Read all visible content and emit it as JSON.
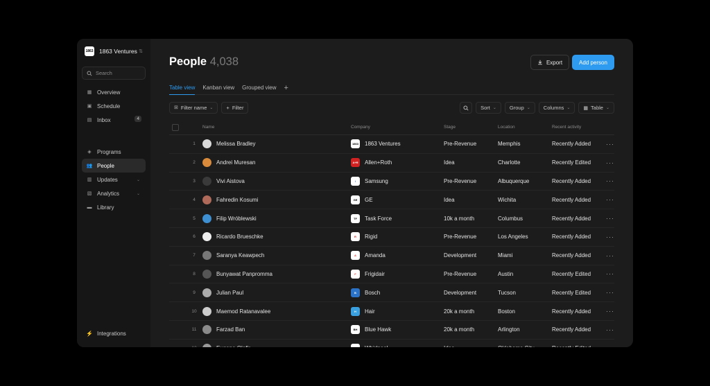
{
  "workspace": {
    "name": "1863 Ventures",
    "logo_text": "1863"
  },
  "search": {
    "placeholder": "Search"
  },
  "nav": {
    "primary": [
      {
        "label": "Overview",
        "icon": "grid-icon"
      },
      {
        "label": "Schedule",
        "icon": "calendar-icon"
      },
      {
        "label": "Inbox",
        "icon": "inbox-icon",
        "badge": "4"
      }
    ],
    "secondary": [
      {
        "label": "Programs",
        "icon": "layers-icon"
      },
      {
        "label": "People",
        "icon": "users-icon",
        "active": true
      },
      {
        "label": "Updates",
        "icon": "updates-icon"
      },
      {
        "label": "Analytics",
        "icon": "chart-icon"
      },
      {
        "label": "Library",
        "icon": "folder-icon"
      }
    ],
    "footer": {
      "label": "Integrations",
      "icon": "bolt-icon"
    }
  },
  "page": {
    "title": "People",
    "count": "4,038"
  },
  "actions": {
    "export": "Export",
    "add": "Add person"
  },
  "tabs": [
    "Table view",
    "Kanban view",
    "Grouped view"
  ],
  "toolbar": {
    "filter_name": "Filter name",
    "filter": "Filter",
    "sort": "Sort",
    "group": "Group",
    "columns": "Columns",
    "table": "Table"
  },
  "table": {
    "headers": {
      "name": "Name",
      "company": "Company",
      "stage": "Stage",
      "location": "Location",
      "activity": "Recent activity"
    },
    "rows": [
      {
        "num": "1",
        "name": "Melissa Bradley",
        "company": "1863 Ventures",
        "stage": "Pre-Revenue",
        "location": "Memphis",
        "activity": "Recently Added",
        "avatar": "#d9d9d9",
        "logo_bg": "#ffffff",
        "logo_fg": "#000000",
        "logo_text": "1863"
      },
      {
        "num": "2",
        "name": "Andrei Muresan",
        "company": "Allen+Roth",
        "stage": "Idea",
        "location": "Charlotte",
        "activity": "Recently Edited",
        "avatar": "#d98a3a",
        "logo_bg": "#d32222",
        "logo_fg": "#ffffff",
        "logo_text": "A+R"
      },
      {
        "num": "3",
        "name": "Vivi Aistova",
        "company": "Samsung",
        "stage": "Pre-Revenue",
        "location": "Albuquerque",
        "activity": "Recently Added",
        "avatar": "#3a3a3a",
        "logo_bg": "#ffffff",
        "logo_fg": "#1f4fd1",
        "logo_text": "/"
      },
      {
        "num": "4",
        "name": "Fahredin Kosumi",
        "company": "GE",
        "stage": "Idea",
        "location": "Wichita",
        "activity": "Recently Added",
        "avatar": "#b06a5a",
        "logo_bg": "#ffffff",
        "logo_fg": "#000000",
        "logo_text": "GE"
      },
      {
        "num": "5",
        "name": "Filip Wróblewski",
        "company": "Task Force",
        "stage": "10k a month",
        "location": "Columbus",
        "activity": "Recently Added",
        "avatar": "#3d8fd1",
        "logo_bg": "#ffffff",
        "logo_fg": "#000000",
        "logo_text": "TF"
      },
      {
        "num": "6",
        "name": "Ricardo Brueschke",
        "company": "Rigid",
        "stage": "Pre-Revenue",
        "location": "Los Angeles",
        "activity": "Recently Added",
        "avatar": "#eeeeee",
        "logo_bg": "#ffffff",
        "logo_fg": "#c22",
        "logo_text": "R"
      },
      {
        "num": "7",
        "name": "Saranya Keawpech",
        "company": "Amanda",
        "stage": "Development",
        "location": "Miami",
        "activity": "Recently Added",
        "avatar": "#777777",
        "logo_bg": "#ffffff",
        "logo_fg": "#e33",
        "logo_text": "A"
      },
      {
        "num": "8",
        "name": "Bunyawat Panpromma",
        "company": "Frigidair",
        "stage": "Pre-Revenue",
        "location": "Austin",
        "activity": "Recently Edited",
        "avatar": "#555555",
        "logo_bg": "#ffffff",
        "logo_fg": "#e44",
        "logo_text": "F"
      },
      {
        "num": "9",
        "name": "Julian Paul",
        "company": "Bosch",
        "stage": "Development",
        "location": "Tucson",
        "activity": "Recently Edited",
        "avatar": "#aaaaaa",
        "logo_bg": "#2a73c8",
        "logo_fg": "#ffffff",
        "logo_text": "B"
      },
      {
        "num": "10",
        "name": "Maemod Ratanavalee",
        "company": "Hair",
        "stage": "20k a month",
        "location": "Boston",
        "activity": "Recently Added",
        "avatar": "#cccccc",
        "logo_bg": "#3aa0e0",
        "logo_fg": "#ffffff",
        "logo_text": "H"
      },
      {
        "num": "11",
        "name": "Farzad Ban",
        "company": "Blue Hawk",
        "stage": "20k a month",
        "location": "Arlington",
        "activity": "Recently Added",
        "avatar": "#8a8a8a",
        "logo_bg": "#ffffff",
        "logo_fg": "#000",
        "logo_text": "BH"
      },
      {
        "num": "12",
        "name": "Eugene Olefir",
        "company": "Whirlpool",
        "stage": "Idea",
        "location": "Oklahoma City",
        "activity": "Recently Edited",
        "avatar": "#999999",
        "logo_bg": "#ffffff",
        "logo_fg": "#000",
        "logo_text": "W"
      }
    ]
  }
}
